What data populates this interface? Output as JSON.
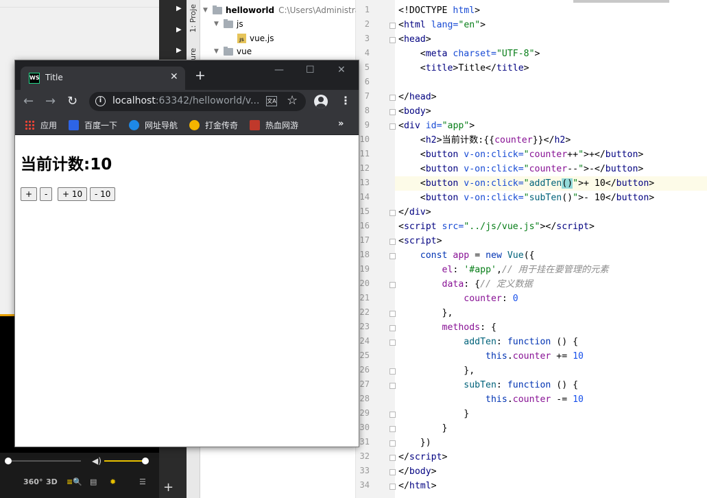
{
  "player": {
    "buttons": [
      "360°",
      "3D"
    ]
  },
  "sidebar": {
    "project_tab": "1: Proje",
    "structure_tab": "ure"
  },
  "tree": {
    "root": "helloworld",
    "root_path": "C:\\Users\\Administrato",
    "folder_js": "js",
    "file_vue": "vue.js",
    "folder_vue": "vue"
  },
  "editor": {
    "line_numbers": [
      "1",
      "2",
      "3",
      "4",
      "5",
      "6",
      "7",
      "8",
      "9",
      "10",
      "11",
      "12",
      "13",
      "14",
      "15",
      "16",
      "17",
      "18",
      "19",
      "20",
      "21",
      "22",
      "23",
      "24",
      "25",
      "26",
      "27",
      "28",
      "29",
      "30",
      "31",
      "32",
      "33",
      "34"
    ]
  },
  "browser": {
    "tab_title": "Title",
    "tab_icon": "WS",
    "url_host": "localhost",
    "url_rest": ":63342/helloworld/v...",
    "bookmarks": [
      "应用",
      "百度一下",
      "网址导航",
      "打金传奇",
      "热血网游"
    ],
    "more": "»",
    "icons": {
      "back": "arrow-left-icon",
      "forward": "arrow-right-icon",
      "reload": "reload-icon",
      "info": "info-icon",
      "translate": "translate-icon",
      "star": "star-icon",
      "account": "account-icon",
      "menu": "menu-icon"
    }
  },
  "page": {
    "heading": "当前计数:10",
    "buttons": [
      "+",
      "-",
      "+ 10",
      "- 10"
    ]
  }
}
